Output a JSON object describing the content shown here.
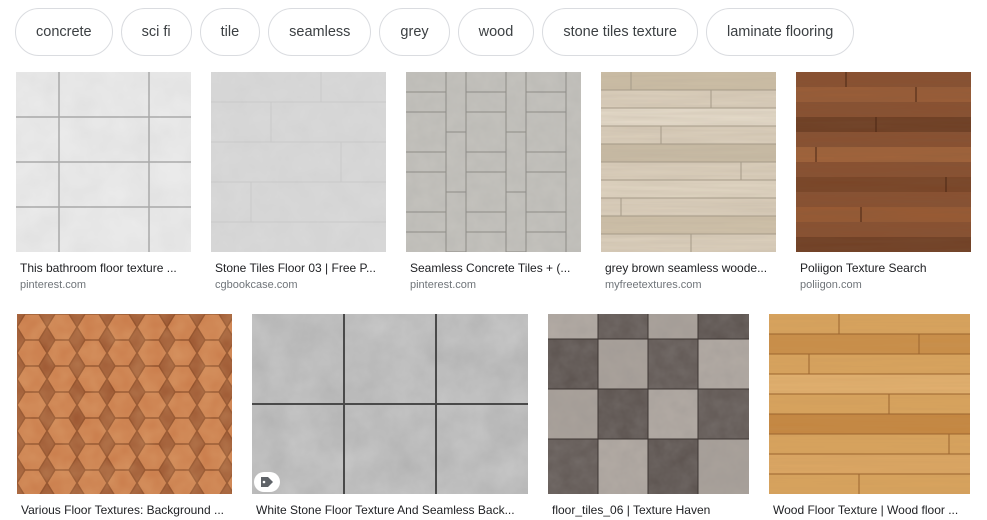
{
  "chips": [
    {
      "label": "concrete"
    },
    {
      "label": "sci fi"
    },
    {
      "label": "tile"
    },
    {
      "label": "seamless"
    },
    {
      "label": "grey"
    },
    {
      "label": "wood"
    },
    {
      "label": "stone tiles texture"
    },
    {
      "label": "laminate flooring"
    }
  ],
  "results": [
    {
      "title": "This bathroom floor texture ...",
      "source": "pinterest.com",
      "icon": "white-marble-tile-thumbnail"
    },
    {
      "title": "Stone Tiles Floor 03 | Free P...",
      "source": "cgbookcase.com",
      "icon": "grey-stone-tiles-thumbnail"
    },
    {
      "title": "Seamless Concrete Tiles + (...",
      "source": "pinterest.com",
      "icon": "herringbone-concrete-thumbnail"
    },
    {
      "title": "grey brown seamless woode...",
      "source": "myfreetextures.com",
      "icon": "light-wood-planks-thumbnail"
    },
    {
      "title": "Poliigon Texture Search",
      "source": "poliigon.com",
      "icon": "dark-wood-planks-thumbnail"
    },
    {
      "title": "Various Floor Textures: Background ...",
      "source": "",
      "icon": "hexagon-terracotta-thumbnail"
    },
    {
      "title": "White Stone Floor Texture And Seamless Back...",
      "source": "",
      "icon": "white-stone-floor-thumbnail",
      "badge": "tag-icon"
    },
    {
      "title": "floor_tiles_06 | Texture Haven",
      "source": "",
      "icon": "checker-tiles-thumbnail"
    },
    {
      "title": "Wood Floor Texture | Wood floor ...",
      "source": "",
      "icon": "oak-wood-floor-thumbnail"
    }
  ]
}
